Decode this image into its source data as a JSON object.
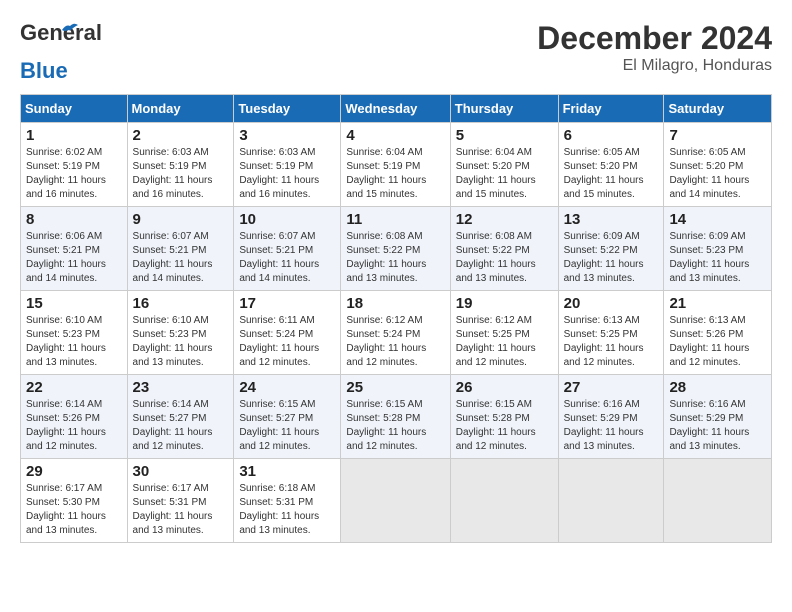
{
  "header": {
    "logo_line1": "General",
    "logo_line2": "Blue",
    "title": "December 2024",
    "subtitle": "El Milagro, Honduras"
  },
  "calendar": {
    "days_of_week": [
      "Sunday",
      "Monday",
      "Tuesday",
      "Wednesday",
      "Thursday",
      "Friday",
      "Saturday"
    ],
    "weeks": [
      [
        {
          "day": "1",
          "info": "Sunrise: 6:02 AM\nSunset: 5:19 PM\nDaylight: 11 hours and 16 minutes."
        },
        {
          "day": "2",
          "info": "Sunrise: 6:03 AM\nSunset: 5:19 PM\nDaylight: 11 hours and 16 minutes."
        },
        {
          "day": "3",
          "info": "Sunrise: 6:03 AM\nSunset: 5:19 PM\nDaylight: 11 hours and 16 minutes."
        },
        {
          "day": "4",
          "info": "Sunrise: 6:04 AM\nSunset: 5:19 PM\nDaylight: 11 hours and 15 minutes."
        },
        {
          "day": "5",
          "info": "Sunrise: 6:04 AM\nSunset: 5:20 PM\nDaylight: 11 hours and 15 minutes."
        },
        {
          "day": "6",
          "info": "Sunrise: 6:05 AM\nSunset: 5:20 PM\nDaylight: 11 hours and 15 minutes."
        },
        {
          "day": "7",
          "info": "Sunrise: 6:05 AM\nSunset: 5:20 PM\nDaylight: 11 hours and 14 minutes."
        }
      ],
      [
        {
          "day": "8",
          "info": "Sunrise: 6:06 AM\nSunset: 5:21 PM\nDaylight: 11 hours and 14 minutes."
        },
        {
          "day": "9",
          "info": "Sunrise: 6:07 AM\nSunset: 5:21 PM\nDaylight: 11 hours and 14 minutes."
        },
        {
          "day": "10",
          "info": "Sunrise: 6:07 AM\nSunset: 5:21 PM\nDaylight: 11 hours and 14 minutes."
        },
        {
          "day": "11",
          "info": "Sunrise: 6:08 AM\nSunset: 5:22 PM\nDaylight: 11 hours and 13 minutes."
        },
        {
          "day": "12",
          "info": "Sunrise: 6:08 AM\nSunset: 5:22 PM\nDaylight: 11 hours and 13 minutes."
        },
        {
          "day": "13",
          "info": "Sunrise: 6:09 AM\nSunset: 5:22 PM\nDaylight: 11 hours and 13 minutes."
        },
        {
          "day": "14",
          "info": "Sunrise: 6:09 AM\nSunset: 5:23 PM\nDaylight: 11 hours and 13 minutes."
        }
      ],
      [
        {
          "day": "15",
          "info": "Sunrise: 6:10 AM\nSunset: 5:23 PM\nDaylight: 11 hours and 13 minutes."
        },
        {
          "day": "16",
          "info": "Sunrise: 6:10 AM\nSunset: 5:23 PM\nDaylight: 11 hours and 13 minutes."
        },
        {
          "day": "17",
          "info": "Sunrise: 6:11 AM\nSunset: 5:24 PM\nDaylight: 11 hours and 12 minutes."
        },
        {
          "day": "18",
          "info": "Sunrise: 6:12 AM\nSunset: 5:24 PM\nDaylight: 11 hours and 12 minutes."
        },
        {
          "day": "19",
          "info": "Sunrise: 6:12 AM\nSunset: 5:25 PM\nDaylight: 11 hours and 12 minutes."
        },
        {
          "day": "20",
          "info": "Sunrise: 6:13 AM\nSunset: 5:25 PM\nDaylight: 11 hours and 12 minutes."
        },
        {
          "day": "21",
          "info": "Sunrise: 6:13 AM\nSunset: 5:26 PM\nDaylight: 11 hours and 12 minutes."
        }
      ],
      [
        {
          "day": "22",
          "info": "Sunrise: 6:14 AM\nSunset: 5:26 PM\nDaylight: 11 hours and 12 minutes."
        },
        {
          "day": "23",
          "info": "Sunrise: 6:14 AM\nSunset: 5:27 PM\nDaylight: 11 hours and 12 minutes."
        },
        {
          "day": "24",
          "info": "Sunrise: 6:15 AM\nSunset: 5:27 PM\nDaylight: 11 hours and 12 minutes."
        },
        {
          "day": "25",
          "info": "Sunrise: 6:15 AM\nSunset: 5:28 PM\nDaylight: 11 hours and 12 minutes."
        },
        {
          "day": "26",
          "info": "Sunrise: 6:15 AM\nSunset: 5:28 PM\nDaylight: 11 hours and 12 minutes."
        },
        {
          "day": "27",
          "info": "Sunrise: 6:16 AM\nSunset: 5:29 PM\nDaylight: 11 hours and 13 minutes."
        },
        {
          "day": "28",
          "info": "Sunrise: 6:16 AM\nSunset: 5:29 PM\nDaylight: 11 hours and 13 minutes."
        }
      ],
      [
        {
          "day": "29",
          "info": "Sunrise: 6:17 AM\nSunset: 5:30 PM\nDaylight: 11 hours and 13 minutes."
        },
        {
          "day": "30",
          "info": "Sunrise: 6:17 AM\nSunset: 5:31 PM\nDaylight: 11 hours and 13 minutes."
        },
        {
          "day": "31",
          "info": "Sunrise: 6:18 AM\nSunset: 5:31 PM\nDaylight: 11 hours and 13 minutes."
        },
        {
          "day": "",
          "info": ""
        },
        {
          "day": "",
          "info": ""
        },
        {
          "day": "",
          "info": ""
        },
        {
          "day": "",
          "info": ""
        }
      ]
    ]
  }
}
